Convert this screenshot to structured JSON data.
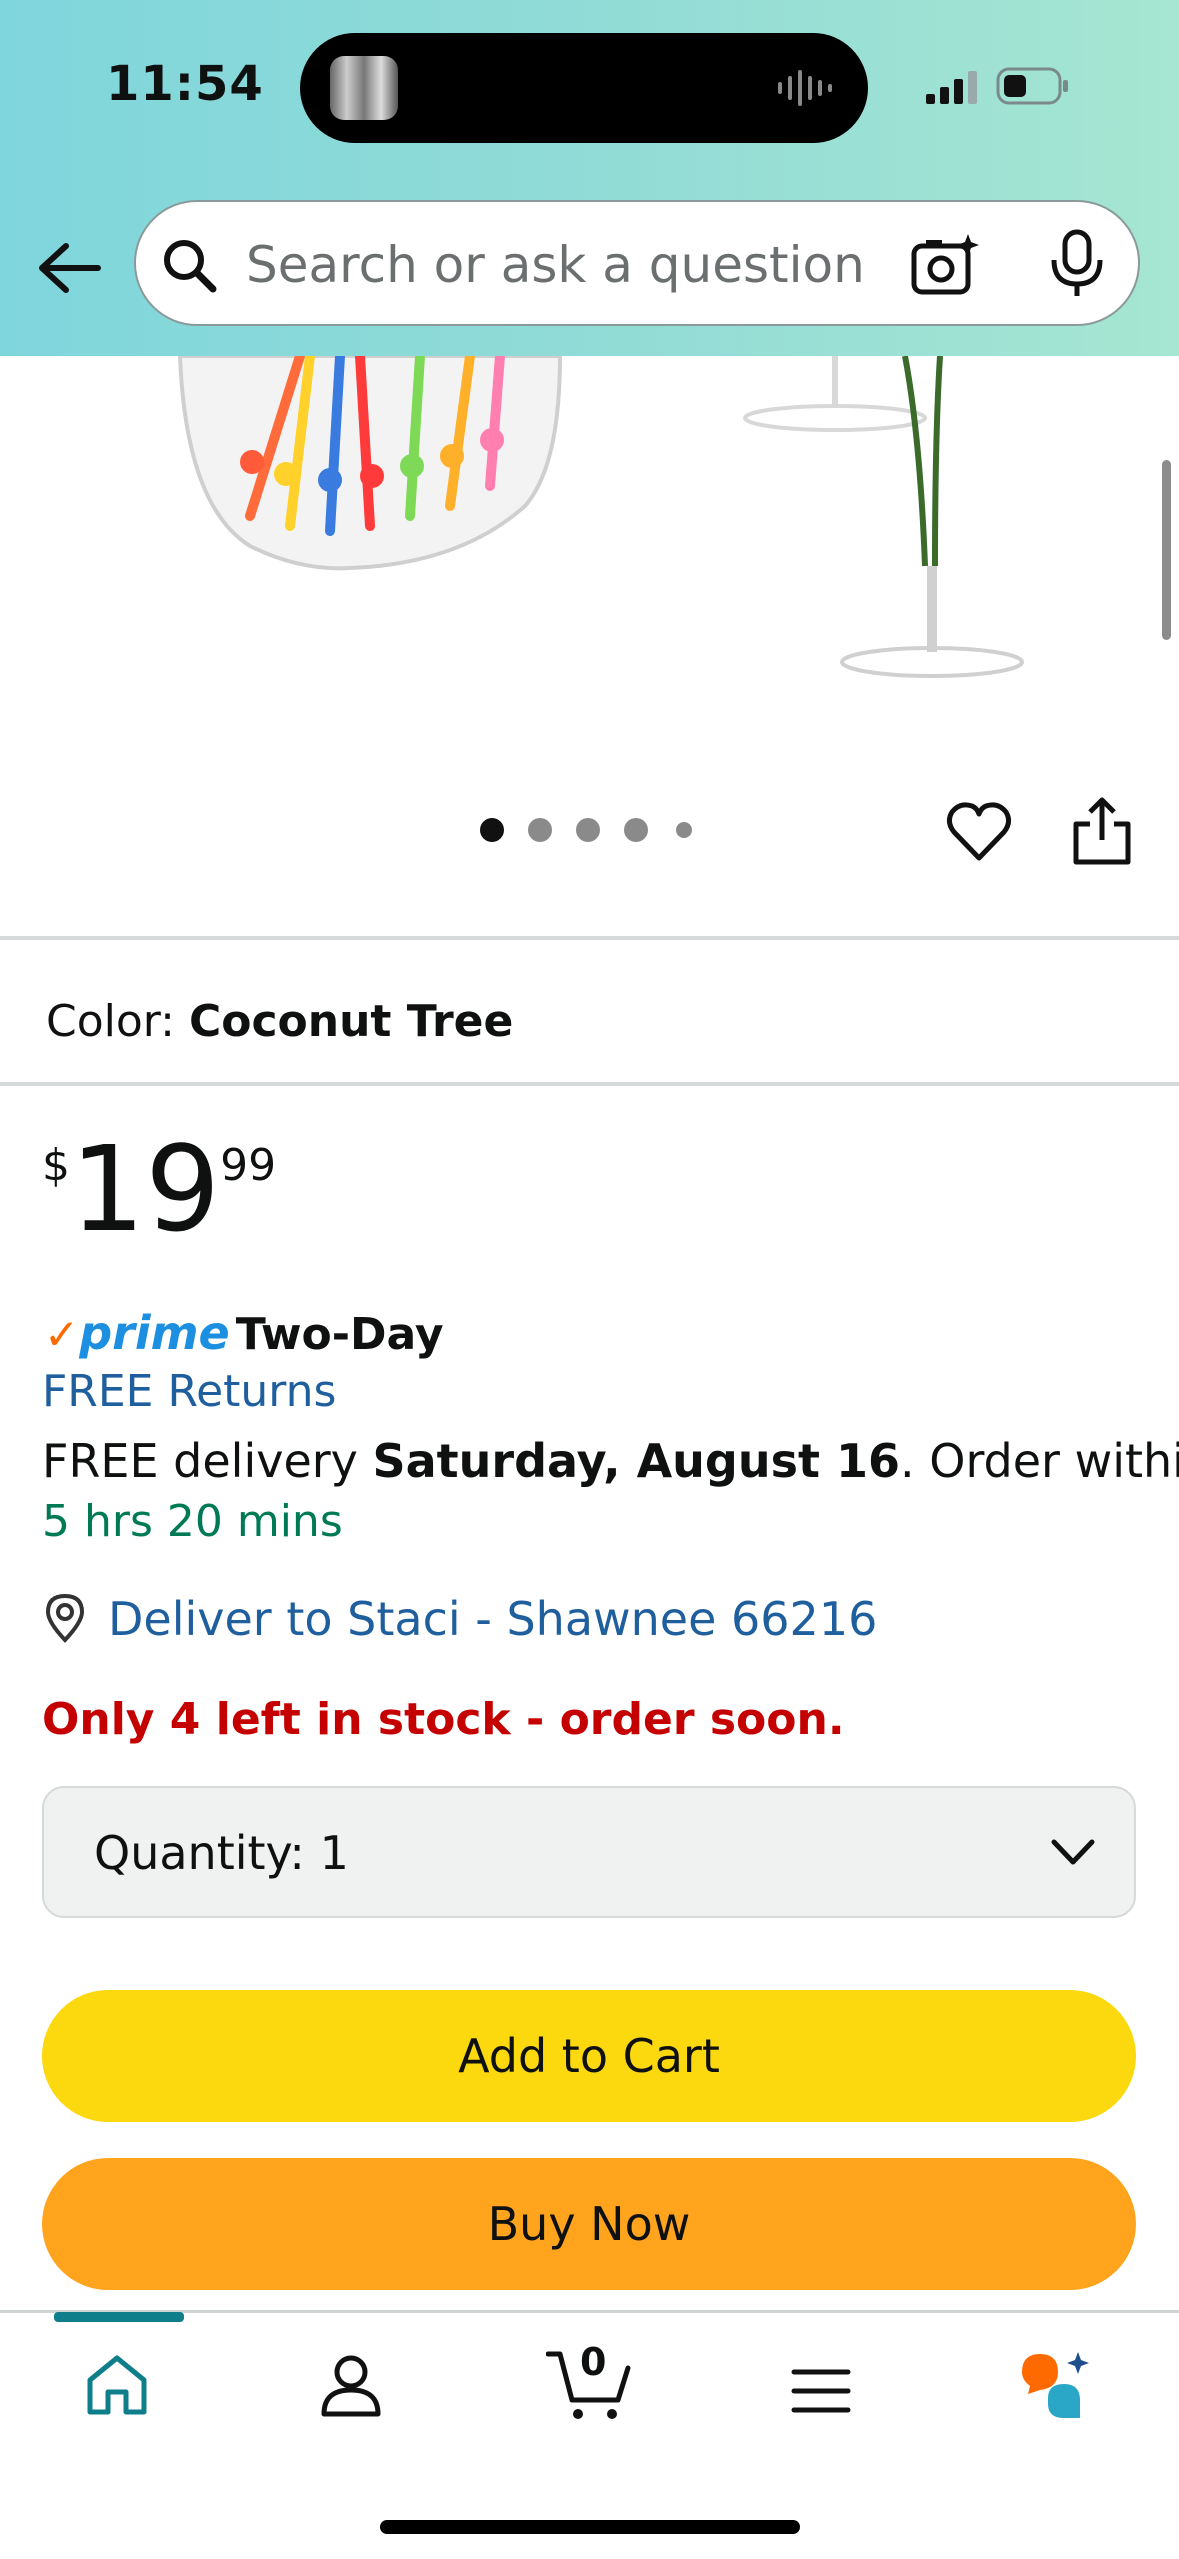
{
  "status_bar": {
    "time": "11:54"
  },
  "search": {
    "placeholder": "Search or ask a question"
  },
  "gallery": {
    "page_count": 5,
    "active_index": 0
  },
  "product": {
    "color_label": "Color:",
    "color_value": "Coconut Tree",
    "price": {
      "currency": "$",
      "whole": "19",
      "fraction": "99"
    }
  },
  "shipping": {
    "prime_word": "prime",
    "prime_speed": "Two-Day",
    "free_returns": "FREE Returns",
    "delivery_prefix": "FREE delivery ",
    "delivery_date": "Saturday, August 16",
    "delivery_suffix": ". Order within",
    "countdown": "5 hrs 20 mins",
    "deliver_to": "Deliver to Staci - Shawnee 66216"
  },
  "stock": {
    "message": "Only 4 left in stock - order soon."
  },
  "quantity": {
    "label": "Quantity:",
    "value": "1"
  },
  "buttons": {
    "add_to_cart": "Add to Cart",
    "buy_now": "Buy Now"
  },
  "bottom_nav": {
    "cart_count": "0",
    "active_tab": "home"
  },
  "colors": {
    "add_to_cart": "#fcd80f",
    "buy_now": "#ffa41c",
    "link": "#1f5f9e",
    "stock_warning": "#c40000",
    "countdown": "#007a55",
    "nav_active": "#0d7e8a"
  }
}
